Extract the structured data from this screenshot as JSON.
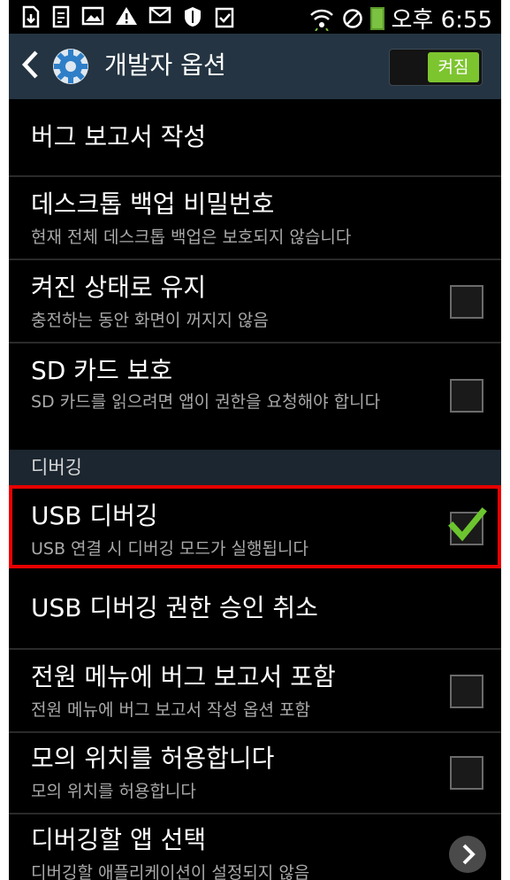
{
  "status": {
    "time": "오후 6:55",
    "icons": [
      "usb-download-icon",
      "document-icon",
      "image-icon",
      "warning-icon",
      "email-icon",
      "shield-icon",
      "clipboard-check-icon",
      "wifi-icon",
      "blocked-icon",
      "battery-icon"
    ]
  },
  "header": {
    "back_icon": "back-arrow-icon",
    "settings_icon": "gear-icon",
    "title": "개발자 옵션",
    "toggle_label": "켜짐",
    "toggle_on": true
  },
  "items": [
    {
      "title": "버그 보고서 작성"
    },
    {
      "title": "데스크톱 백업 비밀번호",
      "summary": "현재 전체 데스크톱 백업은 보호되지 않습니다"
    },
    {
      "title": "켜진 상태로 유지",
      "summary": "충전하는 동안 화면이 꺼지지 않음",
      "checked": false
    },
    {
      "title": "SD 카드 보호",
      "summary": "SD 카드를 읽으려면 앱이 권한을 요청해야 합니다",
      "checked": false
    },
    {
      "title": "USB 디버깅",
      "summary": "USB 연결 시 디버깅 모드가 실행됩니다",
      "checked": true
    },
    {
      "title": "USB 디버깅 권한 승인 취소"
    },
    {
      "title": "전원 메뉴에 버그 보고서 포함",
      "summary": "전원 메뉴에 버그 보고서 작성 옵션 포함",
      "checked": false
    },
    {
      "title": "모의 위치를 허용합니다",
      "summary": "모의 위치를 허용합니다",
      "checked": false
    },
    {
      "title": "디버깅할 앱 선택",
      "summary": "디버깅할 애플리케이션이 설정되지 않음"
    }
  ],
  "section_debugging": "디버깅",
  "colors": {
    "actionbar": "#243442",
    "toggle_on": "#7dc52f",
    "highlight": "#e60000",
    "check": "#6cc52f"
  }
}
